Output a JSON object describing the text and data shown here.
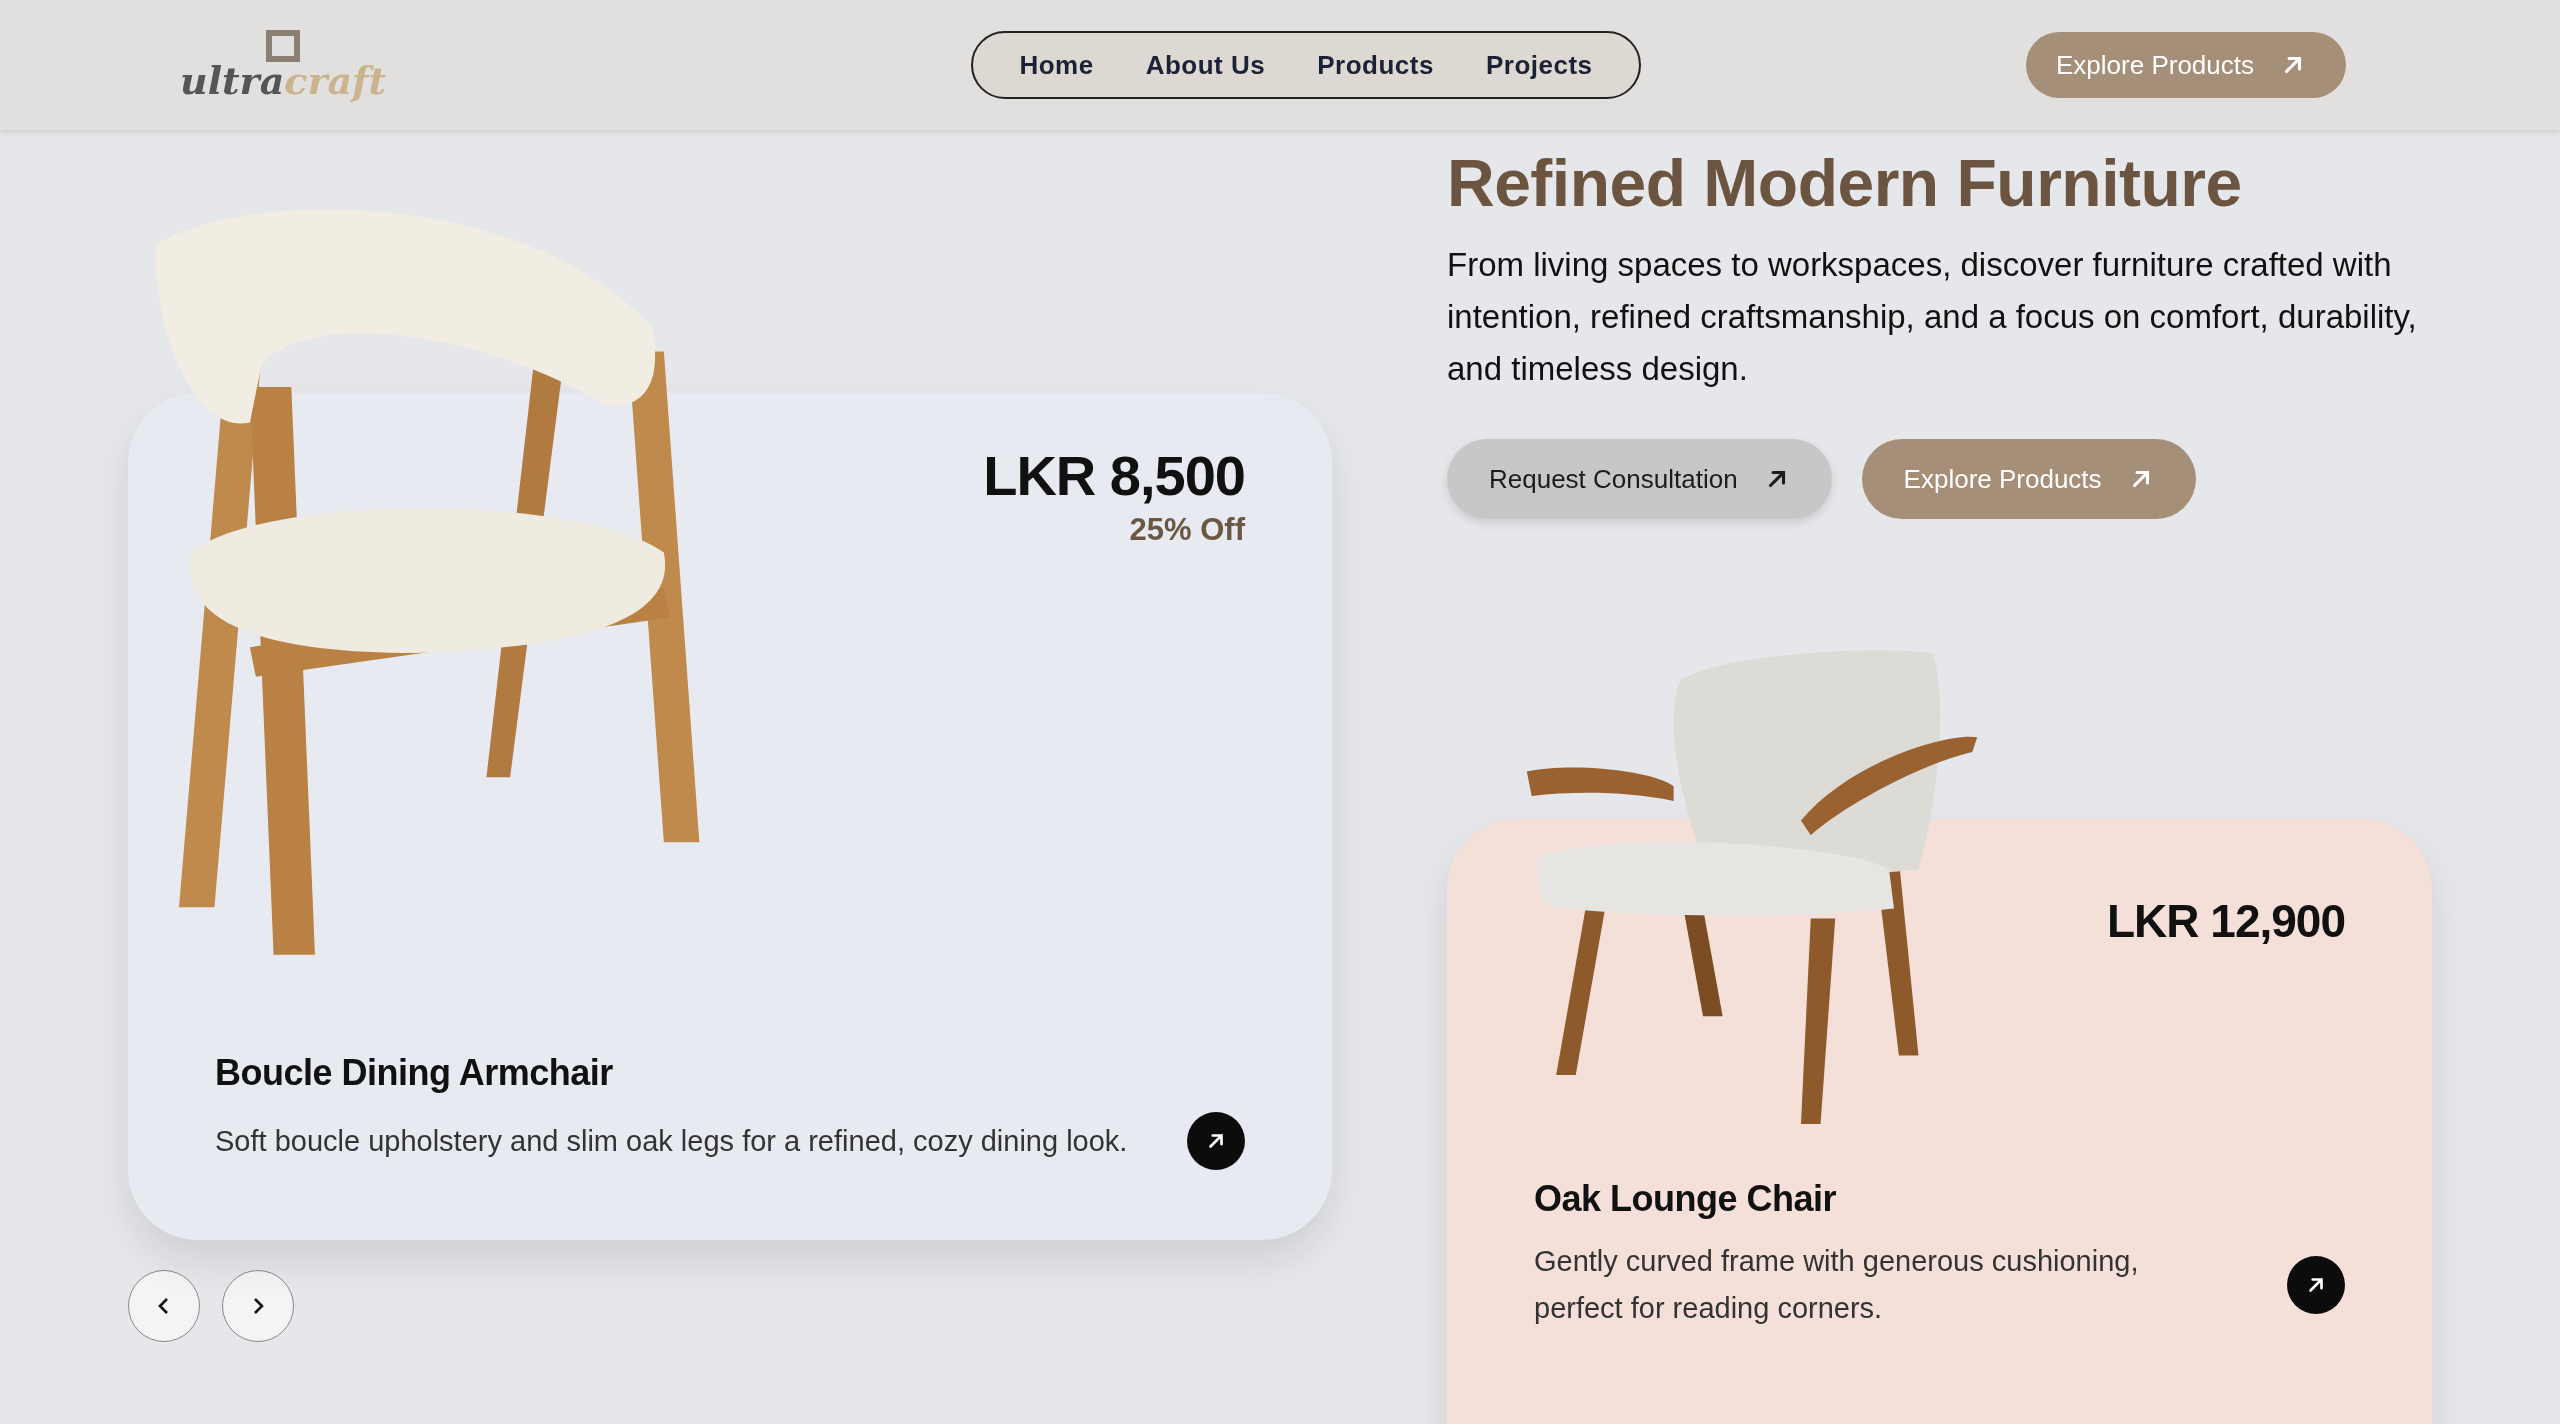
{
  "logo": {
    "word_1": "ultra",
    "word_2": "craft"
  },
  "nav": {
    "items": [
      {
        "label": "Home"
      },
      {
        "label": "About Us"
      },
      {
        "label": "Products"
      },
      {
        "label": "Projects"
      }
    ]
  },
  "header_button": {
    "label": "Explore Products"
  },
  "hero": {
    "title": "Refined Modern Furniture",
    "description": "From living spaces to workspaces, discover furniture crafted with intention, refined craftsmanship, and a focus on comfort, durability, and timeless design.",
    "buttons": [
      {
        "label": "Request Consultation",
        "kind": "secondary"
      },
      {
        "label": "Explore Products",
        "kind": "primary"
      }
    ]
  },
  "products": [
    {
      "name": "Boucle Dining Armchair",
      "description": "Soft boucle upholstery and slim oak legs for a refined, cozy dining look.",
      "price": "LKR 8,500",
      "discount": "25% Off",
      "color": "#e8eaf1",
      "kind": "dining"
    },
    {
      "name": "Oak Lounge Chair",
      "description": "Gently curved frame with generous cushioning, perfect for reading corners.",
      "price": "LKR 12,900",
      "color": "#f4e0d8",
      "kind": "lounge"
    }
  ]
}
